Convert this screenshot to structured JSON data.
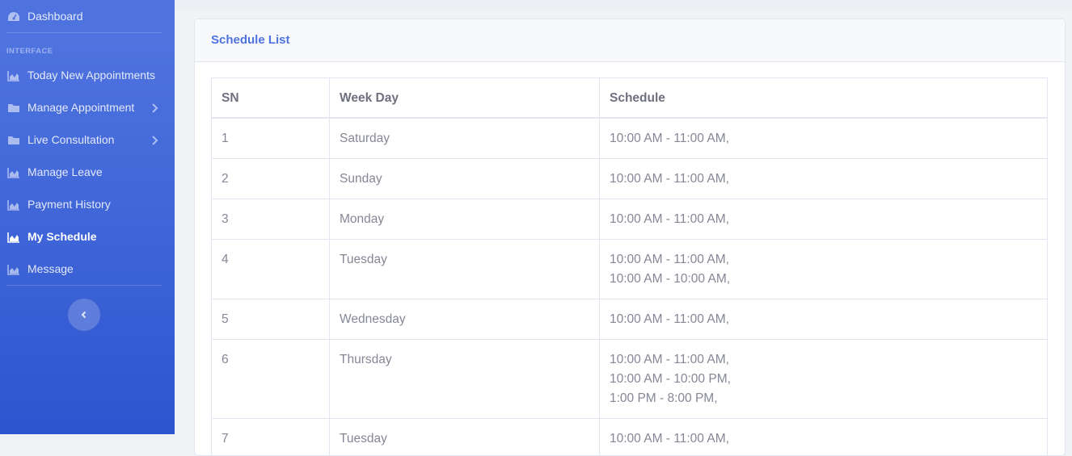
{
  "sidebar": {
    "dashboard_label": "Dashboard",
    "section_heading": "INTERFACE",
    "items": [
      {
        "label": "Today New Appointments",
        "icon": "chart-area-icon"
      },
      {
        "label": "Manage Appointment",
        "icon": "folder-icon"
      },
      {
        "label": "Live Consultation",
        "icon": "folder-icon"
      },
      {
        "label": "Manage Leave",
        "icon": "chart-area-icon"
      },
      {
        "label": "Payment History",
        "icon": "chart-area-icon"
      },
      {
        "label": "My Schedule",
        "icon": "chart-area-icon"
      },
      {
        "label": "Message",
        "icon": "chart-area-icon"
      }
    ],
    "toggle_icon": "chevron-left-icon"
  },
  "card": {
    "title": "Schedule List"
  },
  "table": {
    "headers": [
      "SN",
      "Week Day",
      "Schedule"
    ],
    "rows": [
      {
        "sn": "1",
        "day": "Saturday",
        "schedule": [
          "10:00 AM - 11:00 AM,"
        ]
      },
      {
        "sn": "2",
        "day": "Sunday",
        "schedule": [
          "10:00 AM - 11:00 AM,"
        ]
      },
      {
        "sn": "3",
        "day": "Monday",
        "schedule": [
          "10:00 AM - 11:00 AM,"
        ]
      },
      {
        "sn": "4",
        "day": "Tuesday",
        "schedule": [
          "10:00 AM - 11:00 AM,",
          "10:00 AM - 10:00 AM,"
        ]
      },
      {
        "sn": "5",
        "day": "Wednesday",
        "schedule": [
          "10:00 AM - 11:00 AM,"
        ]
      },
      {
        "sn": "6",
        "day": "Thursday",
        "schedule": [
          "10:00 AM - 11:00 AM,",
          "10:00 AM - 10:00 PM,",
          "1:00 PM - 8:00 PM,"
        ]
      },
      {
        "sn": "7",
        "day": "Tuesday",
        "schedule": [
          "10:00 AM - 11:00 AM,"
        ]
      }
    ]
  },
  "colors": {
    "accent": "#4e73df",
    "sidebar_top": "#4e73df",
    "sidebar_bottom": "#2e55cf",
    "text_muted": "#858796"
  }
}
